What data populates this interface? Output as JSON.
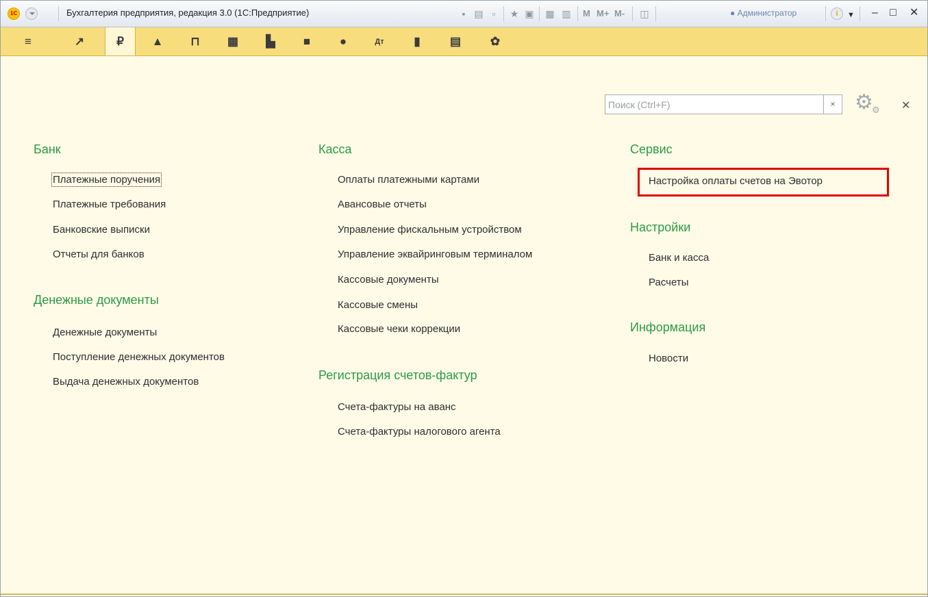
{
  "window": {
    "title": "Бухгалтерия предприятия, редакция 3.0  (1С:Предприятие)",
    "user": "Администратор",
    "memory_buttons": [
      "M",
      "M+",
      "M-"
    ],
    "logo_text": "1С"
  },
  "panel": {
    "sections": [
      {
        "name": "main-menu",
        "icon": "≡"
      },
      {
        "name": "monitor",
        "icon": "〜"
      },
      {
        "name": "bank-cash",
        "icon": "₽",
        "active": true
      },
      {
        "name": "sales",
        "icon": "◆"
      },
      {
        "name": "purchases",
        "icon": "⊓"
      },
      {
        "name": "warehouse",
        "icon": "▦"
      },
      {
        "name": "production",
        "icon": "▙"
      },
      {
        "name": "os-nma",
        "icon": "■"
      },
      {
        "name": "salary-hr",
        "icon": "●"
      },
      {
        "name": "operations",
        "icon": "Дт"
      },
      {
        "name": "reports",
        "icon": "▮"
      },
      {
        "name": "directories",
        "icon": "▤"
      },
      {
        "name": "administration",
        "icon": "✿"
      }
    ]
  },
  "search": {
    "placeholder": "Поиск (Ctrl+F)",
    "value": ""
  },
  "groups": {
    "bank": {
      "title": "Банк",
      "items": [
        "Платежные поручения",
        "Платежные требования",
        "Банковские выписки",
        "Отчеты для банков"
      ]
    },
    "money_docs": {
      "title": "Денежные документы",
      "items": [
        "Денежные документы",
        "Поступление денежных документов",
        "Выдача денежных документов"
      ]
    },
    "cash": {
      "title": "Касса",
      "items": [
        "Оплаты платежными картами",
        "Авансовые отчеты",
        "Управление фискальным устройством",
        "Управление эквайринговым терминалом",
        "Кассовые документы",
        "Кассовые смены",
        "Кассовые чеки коррекции"
      ]
    },
    "invoices": {
      "title": "Регистрация счетов-фактур",
      "items": [
        "Счета-фактуры на аванс",
        "Счета-фактуры налогового агента"
      ]
    },
    "service": {
      "title": "Сервис",
      "items": [
        "Настройка оплаты счетов на Эвотор"
      ]
    },
    "settings": {
      "title": "Настройки",
      "items": [
        "Банк и касса",
        "Расчеты"
      ]
    },
    "info": {
      "title": "Информация",
      "items": [
        "Новости"
      ]
    }
  },
  "colors": {
    "group_title": "#2b9b4a",
    "panel": "#f7dd7c",
    "content_bg": "#fffbe6",
    "highlight": "#e00000"
  }
}
